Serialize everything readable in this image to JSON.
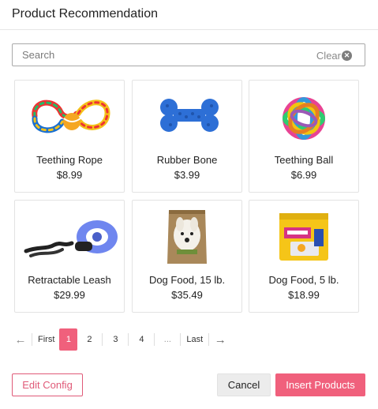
{
  "window": {
    "title": "Product Recommendation"
  },
  "search": {
    "placeholder": "Search",
    "value": "",
    "clear_label": "Clear"
  },
  "products": [
    {
      "name": "Teething Rope",
      "price": "$8.99",
      "icon": "rope-toy-icon"
    },
    {
      "name": "Rubber Bone",
      "price": "$3.99",
      "icon": "bone-toy-icon"
    },
    {
      "name": "Teething Ball",
      "price": "$6.99",
      "icon": "ball-toy-icon"
    },
    {
      "name": "Retractable Leash",
      "price": "$29.99",
      "icon": "leash-icon"
    },
    {
      "name": "Dog Food, 15 lb.",
      "price": "$35.49",
      "icon": "dog-food-bag-icon"
    },
    {
      "name": "Dog Food, 5 lb.",
      "price": "$18.99",
      "icon": "dog-food-bag-small-icon"
    }
  ],
  "pagination": {
    "prev_icon": "←",
    "first_label": "First",
    "pages": [
      "1",
      "2",
      "3",
      "4"
    ],
    "current": "1",
    "ellipsis": "...",
    "last_label": "Last",
    "next_icon": "→"
  },
  "footer": {
    "edit_label": "Edit Config",
    "cancel_label": "Cancel",
    "insert_label": "Insert Products"
  },
  "colors": {
    "accent": "#f0607c",
    "border": "#e3e3e3",
    "text": "#222222"
  }
}
